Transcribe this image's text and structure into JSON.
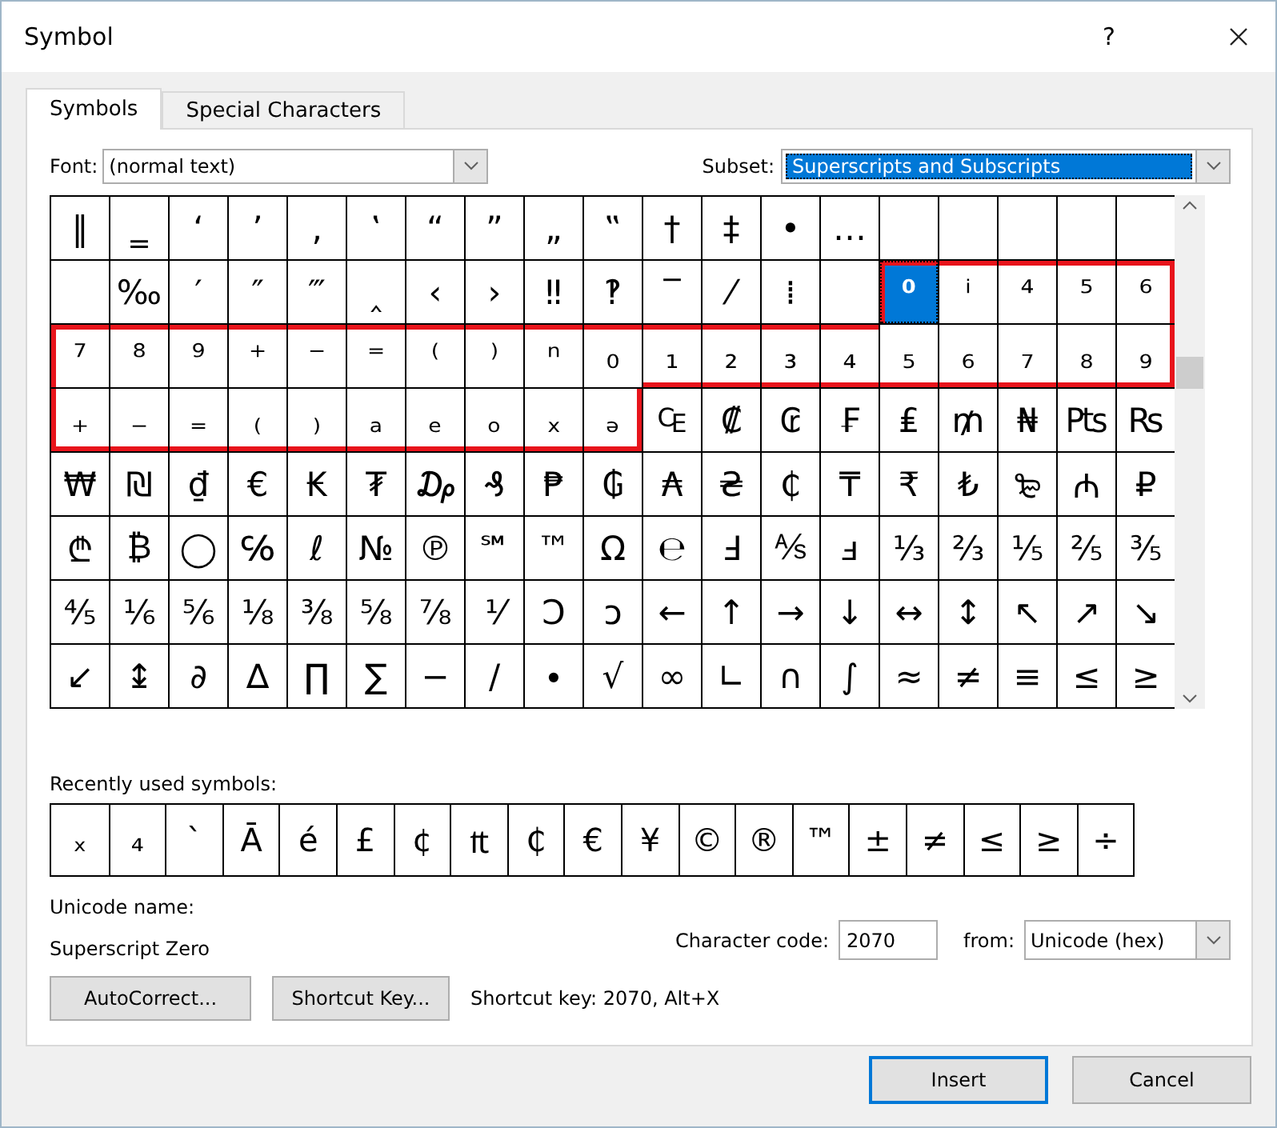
{
  "window": {
    "title": "Symbol",
    "help": "?"
  },
  "tabs": [
    {
      "label": "Symbols",
      "selected": true
    },
    {
      "label": "Special Characters",
      "selected": false
    }
  ],
  "font": {
    "label": "Font:",
    "value": "(normal text)"
  },
  "subset": {
    "label": "Subset:",
    "value": "Superscripts and Subscripts"
  },
  "grid": [
    {
      "cells": [
        {
          "s": "‖",
          "selected": false
        },
        {
          "s": "‗",
          "selected": false
        },
        {
          "s": "‘",
          "selected": false
        },
        {
          "s": "’",
          "selected": false
        },
        {
          "s": "‚",
          "selected": false
        },
        {
          "s": "‛",
          "selected": false
        },
        {
          "s": "“",
          "selected": false
        },
        {
          "s": "”",
          "selected": false
        },
        {
          "s": "„",
          "selected": false
        },
        {
          "s": "‟",
          "selected": false
        },
        {
          "s": "†",
          "selected": false
        },
        {
          "s": "‡",
          "selected": false
        },
        {
          "s": "•",
          "selected": false
        },
        {
          "s": "…",
          "selected": false
        },
        {
          "selected": false
        },
        {
          "selected": false
        },
        {
          "selected": false
        },
        {
          "selected": false
        },
        {
          "selected": false
        }
      ]
    },
    {
      "cells": [
        {
          "selected": false
        },
        {
          "s": "‰",
          "selected": false
        },
        {
          "s": "′",
          "selected": false
        },
        {
          "s": "″",
          "selected": false
        },
        {
          "s": "‴",
          "selected": false
        },
        {
          "s": "‸",
          "selected": false
        },
        {
          "s": "‹",
          "selected": false
        },
        {
          "s": "›",
          "selected": false
        },
        {
          "s": "‼",
          "selected": false
        },
        {
          "s": "‽",
          "selected": false
        },
        {
          "s": "‾",
          "selected": false
        },
        {
          "s": "⁄",
          "selected": false
        },
        {
          "s": "⁞",
          "selected": false
        },
        {
          "selected": false
        },
        {
          "s": "⁰",
          "hl": true,
          "selected": true
        },
        {
          "s": "ⁱ",
          "hl": true,
          "selected": false
        },
        {
          "s": "⁴",
          "hl": true,
          "selected": false
        },
        {
          "s": "⁵",
          "hl": true,
          "selected": false
        },
        {
          "s": "⁶",
          "hl": true,
          "selected": false
        }
      ]
    },
    {
      "cells": [
        {
          "s": "⁷",
          "hl": true,
          "selected": false
        },
        {
          "s": "⁸",
          "hl": true,
          "selected": false
        },
        {
          "s": "⁹",
          "hl": true,
          "selected": false
        },
        {
          "s": "⁺",
          "hl": true,
          "selected": false
        },
        {
          "s": "⁻",
          "hl": true,
          "selected": false
        },
        {
          "s": "⁼",
          "hl": true,
          "selected": false
        },
        {
          "s": "⁽",
          "hl": true,
          "selected": false
        },
        {
          "s": "⁾",
          "hl": true,
          "selected": false
        },
        {
          "s": "ⁿ",
          "hl": true,
          "selected": false
        },
        {
          "s": "₀",
          "hl": true,
          "selected": false
        },
        {
          "s": "₁",
          "hl": true,
          "selected": false
        },
        {
          "s": "₂",
          "hl": true,
          "selected": false
        },
        {
          "s": "₃",
          "hl": true,
          "selected": false
        },
        {
          "s": "₄",
          "hl": true,
          "selected": false
        },
        {
          "s": "₅",
          "hl": true,
          "selected": false
        },
        {
          "s": "₆",
          "hl": true,
          "selected": false
        },
        {
          "s": "₇",
          "hl": true,
          "selected": false
        },
        {
          "s": "₈",
          "hl": true,
          "selected": false
        },
        {
          "s": "₉",
          "hl": true,
          "selected": false
        }
      ]
    },
    {
      "cells": [
        {
          "s": "₊",
          "hl": true,
          "selected": false
        },
        {
          "s": "₋",
          "hl": true,
          "selected": false
        },
        {
          "s": "₌",
          "hl": true,
          "selected": false
        },
        {
          "s": "₍",
          "hl": true,
          "selected": false
        },
        {
          "s": "₎",
          "hl": true,
          "selected": false
        },
        {
          "s": "ₐ",
          "hl": true,
          "selected": false
        },
        {
          "s": "ₑ",
          "hl": true,
          "selected": false
        },
        {
          "s": "ₒ",
          "hl": true,
          "selected": false
        },
        {
          "s": "ₓ",
          "hl": true,
          "selected": false
        },
        {
          "s": "ₔ",
          "hl": true,
          "selected": false
        },
        {
          "s": "₠",
          "selected": false
        },
        {
          "s": "₡",
          "selected": false
        },
        {
          "s": "₢",
          "selected": false
        },
        {
          "s": "₣",
          "selected": false
        },
        {
          "s": "₤",
          "selected": false
        },
        {
          "s": "₥",
          "selected": false
        },
        {
          "s": "₦",
          "selected": false
        },
        {
          "s": "₧",
          "selected": false
        },
        {
          "s": "₨",
          "selected": false
        }
      ]
    },
    {
      "cells": [
        {
          "s": "₩",
          "selected": false
        },
        {
          "s": "₪",
          "selected": false
        },
        {
          "s": "₫",
          "selected": false
        },
        {
          "s": "€",
          "selected": false
        },
        {
          "s": "₭",
          "selected": false
        },
        {
          "s": "₮",
          "selected": false
        },
        {
          "s": "₯",
          "selected": false
        },
        {
          "s": "₰",
          "selected": false
        },
        {
          "s": "₱",
          "selected": false
        },
        {
          "s": "₲",
          "selected": false
        },
        {
          "s": "₳",
          "selected": false
        },
        {
          "s": "₴",
          "selected": false
        },
        {
          "s": "₵",
          "selected": false
        },
        {
          "s": "₸",
          "selected": false
        },
        {
          "s": "₹",
          "selected": false
        },
        {
          "s": "₺",
          "selected": false
        },
        {
          "s": "₻",
          "selected": false
        },
        {
          "s": "₼",
          "selected": false
        },
        {
          "s": "₽",
          "selected": false
        }
      ]
    },
    {
      "cells": [
        {
          "s": "₾",
          "selected": false
        },
        {
          "s": "₿",
          "selected": false
        },
        {
          "s": "◯",
          "selected": false
        },
        {
          "s": "℅",
          "selected": false
        },
        {
          "s": "ℓ",
          "selected": false
        },
        {
          "s": "№",
          "selected": false
        },
        {
          "s": "℗",
          "selected": false
        },
        {
          "s": "℠",
          "selected": false
        },
        {
          "s": "™",
          "selected": false
        },
        {
          "s": "Ω",
          "selected": false
        },
        {
          "s": "℮",
          "selected": false
        },
        {
          "s": "Ⅎ",
          "selected": false
        },
        {
          "s": "⅍",
          "selected": false
        },
        {
          "s": "ⅎ",
          "selected": false
        },
        {
          "s": "⅓",
          "selected": false
        },
        {
          "s": "⅔",
          "selected": false
        },
        {
          "s": "⅕",
          "selected": false
        },
        {
          "s": "⅖",
          "selected": false
        },
        {
          "s": "⅗",
          "selected": false
        }
      ]
    },
    {
      "cells": [
        {
          "s": "⅘",
          "selected": false
        },
        {
          "s": "⅙",
          "selected": false
        },
        {
          "s": "⅚",
          "selected": false
        },
        {
          "s": "⅛",
          "selected": false
        },
        {
          "s": "⅜",
          "selected": false
        },
        {
          "s": "⅝",
          "selected": false
        },
        {
          "s": "⅞",
          "selected": false
        },
        {
          "s": "⅟",
          "selected": false
        },
        {
          "s": "Ↄ",
          "selected": false
        },
        {
          "s": "ↄ",
          "selected": false
        },
        {
          "s": "←",
          "selected": false
        },
        {
          "s": "↑",
          "selected": false
        },
        {
          "s": "→",
          "selected": false
        },
        {
          "s": "↓",
          "selected": false
        },
        {
          "s": "↔",
          "selected": false
        },
        {
          "s": "↕",
          "selected": false
        },
        {
          "s": "↖",
          "selected": false
        },
        {
          "s": "↗",
          "selected": false
        },
        {
          "s": "↘",
          "selected": false
        }
      ]
    },
    {
      "cells": [
        {
          "s": "↙",
          "selected": false
        },
        {
          "s": "↨",
          "selected": false
        },
        {
          "s": "∂",
          "selected": false
        },
        {
          "s": "∆",
          "selected": false
        },
        {
          "s": "∏",
          "selected": false
        },
        {
          "s": "∑",
          "selected": false
        },
        {
          "s": "−",
          "selected": false
        },
        {
          "s": "∕",
          "selected": false
        },
        {
          "s": "∙",
          "selected": false
        },
        {
          "s": "√",
          "selected": false
        },
        {
          "s": "∞",
          "selected": false
        },
        {
          "s": "∟",
          "selected": false
        },
        {
          "s": "∩",
          "selected": false
        },
        {
          "s": "∫",
          "selected": false
        },
        {
          "s": "≈",
          "selected": false
        },
        {
          "s": "≠",
          "selected": false
        },
        {
          "s": "≡",
          "selected": false
        },
        {
          "s": "≤",
          "selected": false
        },
        {
          "s": "≥",
          "selected": false
        }
      ]
    }
  ],
  "recent": {
    "label": "Recently used symbols:",
    "symbols": [
      "ₓ",
      "₄",
      "`",
      "Ā",
      "é",
      "£",
      "¢",
      "₶",
      "₵",
      "€",
      "¥",
      "©",
      "®",
      "™",
      "±",
      "≠",
      "≤",
      "≥",
      "÷"
    ]
  },
  "unicode_name": {
    "label": "Unicode name:",
    "value": "Superscript Zero"
  },
  "character_code": {
    "label": "Character code:",
    "value": "2070"
  },
  "from": {
    "label": "from:",
    "value": "Unicode (hex)"
  },
  "autocorrect_button": "AutoCorrect...",
  "shortcut_key_button": "Shortcut Key...",
  "shortcut_text": "Shortcut key: 2070, Alt+X",
  "footer_buttons": [
    {
      "label": "Insert",
      "default": true
    },
    {
      "label": "Cancel",
      "default": false
    }
  ]
}
